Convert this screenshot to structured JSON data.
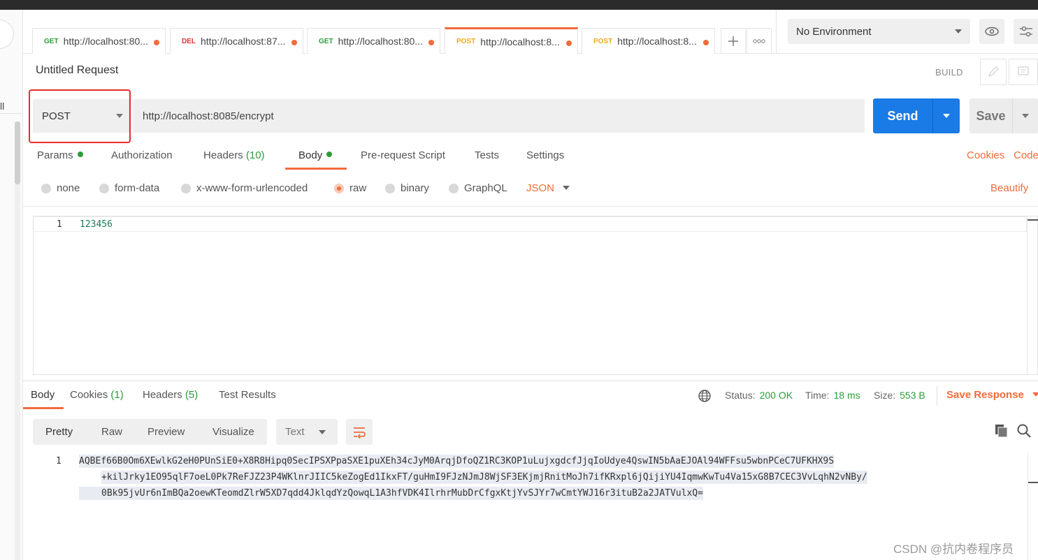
{
  "tabs": [
    {
      "method": "GET",
      "url": "http://localhost:80..."
    },
    {
      "method": "DEL",
      "url": "http://localhost:87..."
    },
    {
      "method": "GET",
      "url": "http://localhost:80..."
    },
    {
      "method": "POST",
      "url": "http://localhost:8..."
    },
    {
      "method": "POST",
      "url": "http://localhost:8..."
    }
  ],
  "environment": {
    "selected": "No Environment"
  },
  "request": {
    "title": "Untitled Request",
    "build_label": "BUILD",
    "method": "POST",
    "url": "http://localhost:8085/encrypt",
    "send_label": "Send",
    "save_label": "Save"
  },
  "request_tabs": {
    "params": "Params",
    "authorization": "Authorization",
    "headers": "Headers",
    "headers_count": "(10)",
    "body": "Body",
    "prerequest": "Pre-request Script",
    "tests": "Tests",
    "settings": "Settings",
    "cookies": "Cookies",
    "code": "Code"
  },
  "body_types": {
    "none": "none",
    "form_data": "form-data",
    "urlencoded": "x-www-form-urlencoded",
    "raw": "raw",
    "binary": "binary",
    "graphql": "GraphQL",
    "format": "JSON",
    "beautify": "Beautify",
    "selected": "raw"
  },
  "editor": {
    "line_number": "1",
    "content": "123456"
  },
  "response_tabs": {
    "body": "Body",
    "cookies": "Cookies",
    "cookies_count": "(1)",
    "headers": "Headers",
    "headers_count": "(5)",
    "test_results": "Test Results"
  },
  "response_status": {
    "status_label": "Status:",
    "status_value": "200 OK",
    "time_label": "Time:",
    "time_value": "18 ms",
    "size_label": "Size:",
    "size_value": "553 B",
    "save_response": "Save Response"
  },
  "response_view": {
    "pretty": "Pretty",
    "raw": "Raw",
    "preview": "Preview",
    "visualize": "Visualize",
    "format": "Text"
  },
  "response_body": {
    "line_number": "1",
    "lines": [
      "AQBEf66B0Om6XEwlkG2eH0PUnSiE0+X8R8Hipq0SecIPSXPpaSXE1puXEh34cJyM0ArqjDfoQZ1RC3KOP1uLujxgdcfJjqIoUdye4QswIN5bAaEJOAl94WFFsu5wbnPCeC7UFKHX9S",
      "+kilJrky1EO95qlF7oeL0Pk7ReFJZ23P4WKlnrJIIC5keZogEd1IkxFT/guHmI9FJzNJmJ8WjSF3EKjmjRnitMoJh7ifKRxpl6jQijiYU4IqmwKwTu4Va15xG8B7CEC3VvLqhN2vNBy/",
      "0Bk95jvUr6nImBQa2oewKTeomdZlrW5XD7qdd4JklqdYzQowqL1A3hfVDK4IlrhrMubDrCfgxKtjYvSJYr7wCmtYWJ16r3ituB2a2JATVulxQ="
    ]
  },
  "watermark": "CSDN @抗内卷程序员",
  "colors": {
    "accent": "#f26b3a",
    "send": "#1a7be6",
    "success": "#2c9c3a",
    "highlight": "#e82c2c"
  }
}
